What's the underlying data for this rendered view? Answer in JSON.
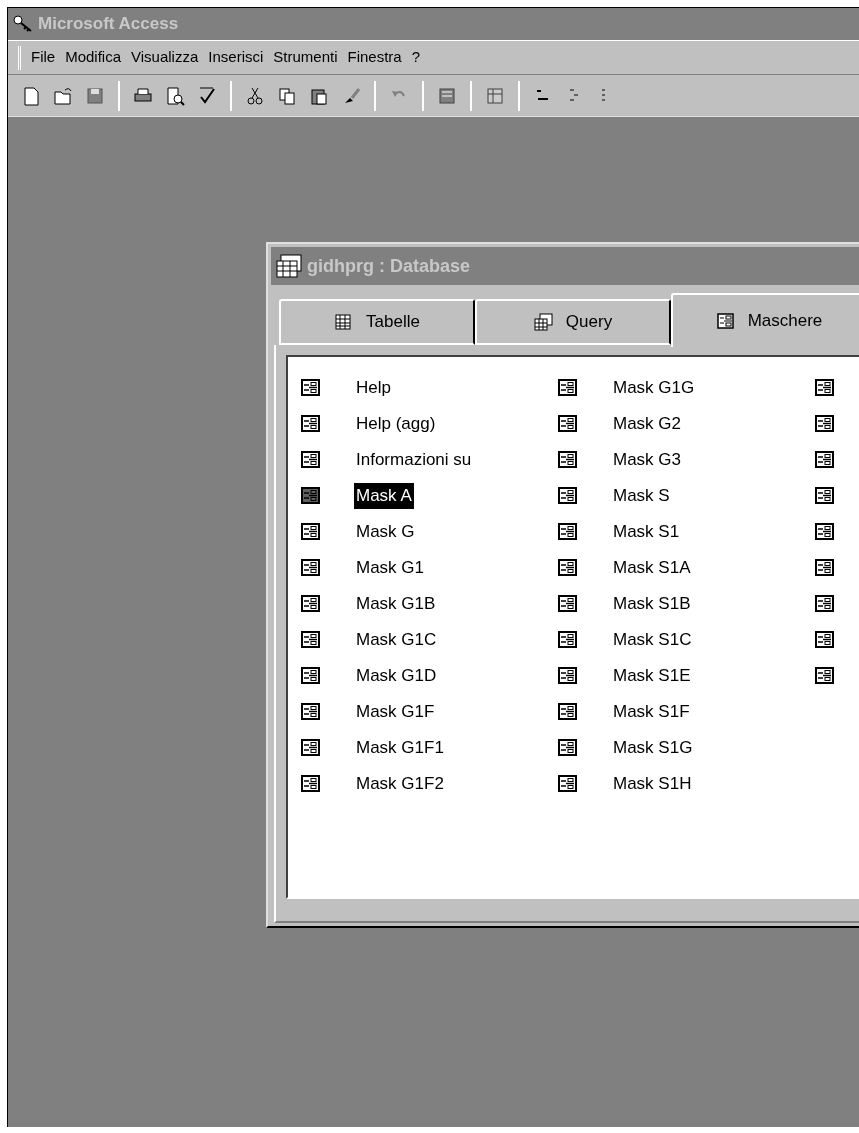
{
  "app_window": {
    "title": "Microsoft Access"
  },
  "menu": [
    "File",
    "Modifica",
    "Visualizza",
    "Inserisci",
    "Strumenti",
    "Finestra",
    "?"
  ],
  "database_window": {
    "title": "gidhprg : Database",
    "tabs": [
      {
        "label": "Tabelle",
        "kind": "table",
        "selected": false
      },
      {
        "label": "Query",
        "kind": "query",
        "selected": false
      },
      {
        "label": "Maschere",
        "kind": "form",
        "selected": true
      }
    ],
    "columns": [
      [
        {
          "label": "Help",
          "selected": false
        },
        {
          "label": "Help (agg)",
          "selected": false
        },
        {
          "label": "Informazioni su",
          "selected": false
        },
        {
          "label": "Mask A",
          "selected": true
        },
        {
          "label": "Mask G",
          "selected": false
        },
        {
          "label": "Mask G1",
          "selected": false
        },
        {
          "label": "Mask G1B",
          "selected": false
        },
        {
          "label": "Mask G1C",
          "selected": false
        },
        {
          "label": "Mask G1D",
          "selected": false
        },
        {
          "label": "Mask G1F",
          "selected": false
        },
        {
          "label": "Mask G1F1",
          "selected": false
        },
        {
          "label": "Mask G1F2",
          "selected": false
        }
      ],
      [
        {
          "label": "Mask G1G",
          "selected": false
        },
        {
          "label": "Mask G2",
          "selected": false
        },
        {
          "label": "Mask G3",
          "selected": false
        },
        {
          "label": "Mask S",
          "selected": false
        },
        {
          "label": "Mask S1",
          "selected": false
        },
        {
          "label": "Mask S1A",
          "selected": false
        },
        {
          "label": "Mask S1B",
          "selected": false
        },
        {
          "label": "Mask S1C",
          "selected": false
        },
        {
          "label": "Mask S1E",
          "selected": false
        },
        {
          "label": "Mask S1F",
          "selected": false
        },
        {
          "label": "Mask S1G",
          "selected": false
        },
        {
          "label": "Mask S1H",
          "selected": false
        }
      ],
      [
        {
          "selected": false
        },
        {
          "selected": false
        },
        {
          "selected": false
        },
        {
          "selected": false
        },
        {
          "selected": false
        },
        {
          "selected": false
        },
        {
          "selected": false
        },
        {
          "selected": false
        },
        {
          "selected": false
        }
      ]
    ]
  }
}
